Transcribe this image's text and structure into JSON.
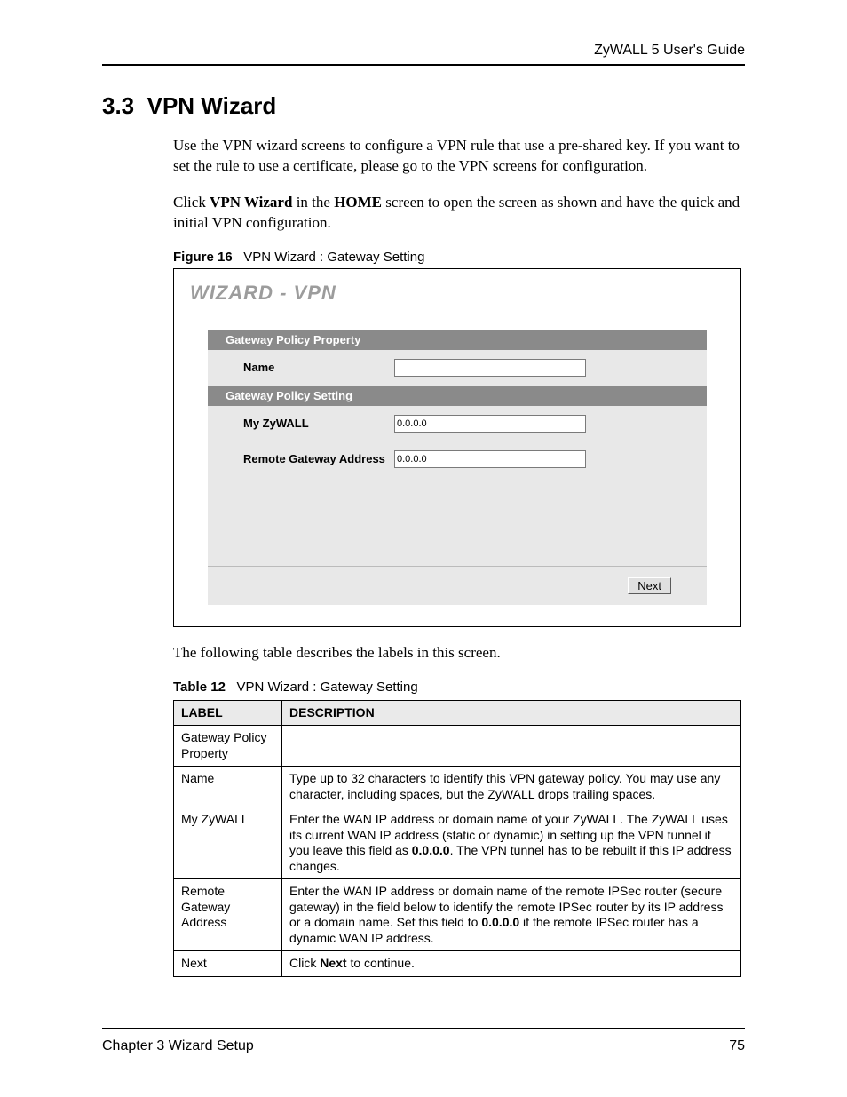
{
  "running_head": "ZyWALL 5 User's Guide",
  "section": {
    "number": "3.3",
    "title": "VPN Wizard"
  },
  "paragraphs": {
    "p1": "Use the VPN wizard screens to configure a VPN rule that use a pre-shared key. If you want to set the rule to use a certificate, please go to the VPN screens for configuration.",
    "p2_a": "Click ",
    "p2_b": "VPN Wizard",
    "p2_c": " in the ",
    "p2_d": "HOME",
    "p2_e": " screen to open the screen as shown and have the quick and initial VPN configuration.",
    "after_figure": "The following table describes the labels in this screen."
  },
  "figure": {
    "label": "Figure 16",
    "caption": "VPN Wizard : Gateway Setting",
    "wizard_title": "WIZARD - VPN",
    "headers": {
      "property": "Gateway Policy Property",
      "setting": "Gateway Policy Setting"
    },
    "rows": {
      "name_label": "Name",
      "name_value": "",
      "myzy_label": "My ZyWALL",
      "myzy_value": "0.0.0.0",
      "remote_label": "Remote Gateway Address",
      "remote_value": "0.0.0.0"
    },
    "next_button": "Next"
  },
  "table": {
    "label": "Table 12",
    "caption": "VPN Wizard : Gateway Setting",
    "headers": {
      "col1": "LABEL",
      "col2": "DESCRIPTION"
    },
    "rows": [
      {
        "label": "Gateway Policy Property",
        "desc": ""
      },
      {
        "label": "Name",
        "desc": "Type up to 32 characters to identify this VPN gateway policy. You may use any character, including spaces, but the ZyWALL drops trailing spaces."
      },
      {
        "label": "My ZyWALL",
        "desc_a": "Enter the WAN IP address or domain name of your ZyWALL. The ZyWALL uses its current WAN IP address (static or dynamic) in setting up the VPN tunnel if you leave this field as ",
        "desc_b": "0.0.0.0",
        "desc_c": ". The VPN tunnel has to be rebuilt if this IP address changes."
      },
      {
        "label": "Remote Gateway Address",
        "desc_a": "Enter the WAN IP address or domain name of the remote IPSec router (secure gateway) in the field below to identify the remote IPSec router by its IP address or a domain name. Set this field to ",
        "desc_b": "0.0.0.0",
        "desc_c": " if the remote IPSec router has a dynamic WAN IP address."
      },
      {
        "label": "Next",
        "desc_a": "Click ",
        "desc_b": "Next",
        "desc_c": " to continue."
      }
    ]
  },
  "footer": {
    "chapter": "Chapter 3 Wizard Setup",
    "page": "75"
  }
}
